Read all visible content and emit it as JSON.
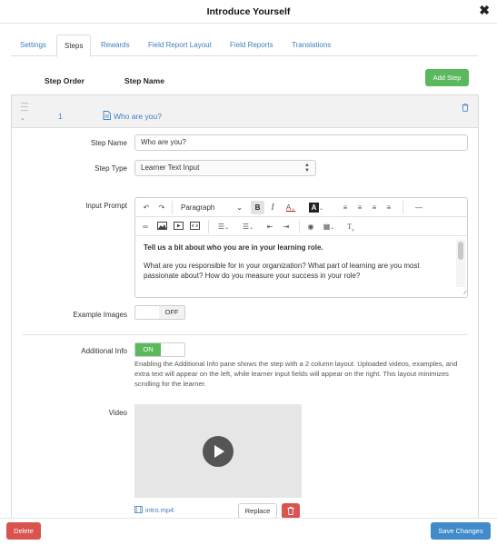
{
  "modal": {
    "title": "Introduce Yourself",
    "close_icon": "close-icon"
  },
  "tabs": [
    {
      "label": "Settings"
    },
    {
      "label": "Steps",
      "active": true
    },
    {
      "label": "Rewards"
    },
    {
      "label": "Field Report Layout"
    },
    {
      "label": "Field Reports"
    },
    {
      "label": "Translations"
    }
  ],
  "list": {
    "col_order": "Step Order",
    "col_name": "Step Name",
    "add_button": "Add Step"
  },
  "step": {
    "order": "1",
    "name": "Who are you?"
  },
  "form": {
    "step_name_label": "Step Name",
    "step_name_value": "Who are you?",
    "step_type_label": "Step Type",
    "step_type_value": "Learner Text Input",
    "input_prompt_label": "Input Prompt",
    "example_images_label": "Example Images",
    "example_images_state": "OFF",
    "additional_info_label": "Additional Info",
    "additional_info_state": "ON",
    "additional_info_help": "Enabling the Additional Info pane shows the step with a 2 column layout. Uploaded videos, examples, and extra text will appear on the left, while learner input fields will appear on the right. This layout minimizes scrolling for the learner.",
    "video_label": "Video",
    "video_file": "intro.mp4",
    "replace_button": "Replace"
  },
  "editor": {
    "block_format": "Paragraph",
    "content_bold": "Tell us a bit about who you are in your learning role.",
    "content_body": "What are you responsible for in your organization? What part of learning are you most passionate about? How do you measure your success in your role?"
  },
  "footer": {
    "delete_button": "Delete",
    "save_button": "Save Changes"
  },
  "colors": {
    "accent_blue": "#3f7fc1",
    "success_green": "#5cb85c",
    "danger_red": "#d9534f",
    "primary_blue": "#428bca"
  }
}
